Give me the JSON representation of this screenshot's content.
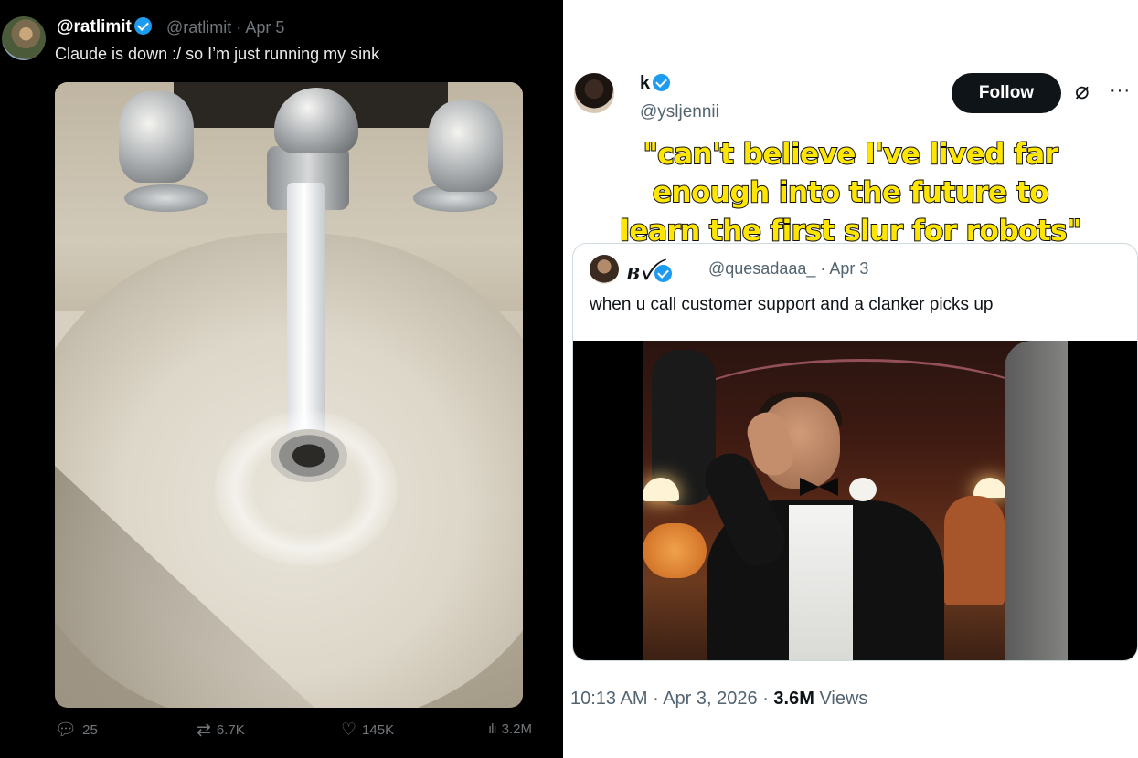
{
  "left_tweet": {
    "display_name": "@ratlimit",
    "handle": "@ratlimit",
    "date": "Apr 5",
    "text": "Claude is down :/ so I’m just running my sink",
    "actions": {
      "replies": "25",
      "reposts": "6.7K",
      "likes": "145K",
      "views": "3.2M"
    },
    "icons": {
      "reply": "reply-icon",
      "repost": "repost-icon",
      "like": "heart-icon",
      "views": "views-chart-icon"
    }
  },
  "right_tweet": {
    "display_name": "k",
    "handle": "@ysljennii",
    "follow_label": "Follow",
    "caption_lines": [
      "\"can't believe I've lived far",
      "enough into the future to",
      "learn the first slur for robots\""
    ],
    "quoted": {
      "display_name": "Bꪜ",
      "handle": "@quesadaaa_",
      "date": "Apr 3",
      "text": "when u call customer support and a clanker picks up"
    },
    "meta": {
      "time": "10:13 AM",
      "date": "Apr 3, 2026",
      "views_count": "3.6M",
      "views_label": "Views"
    }
  },
  "colors": {
    "left_bg": "#000000",
    "right_bg": "#ffffff",
    "verified_blue": "#1d9bf0",
    "caption_yellow": "#ffe600",
    "muted_dark": "#71767b",
    "muted_light": "#536471"
  }
}
